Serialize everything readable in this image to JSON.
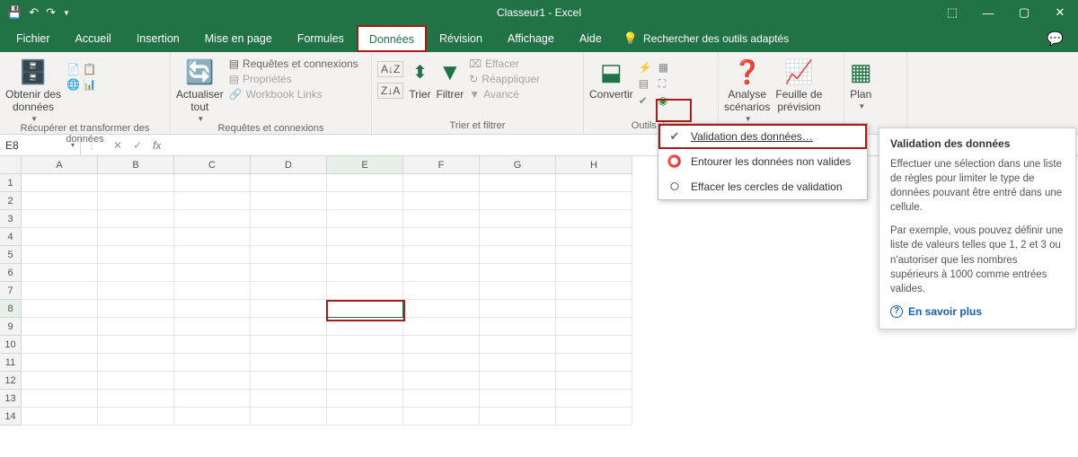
{
  "title": "Classeur1  -  Excel",
  "qat": {
    "save": "💾",
    "undo": "↶",
    "redo": "↷"
  },
  "win": {
    "opts": "⬚",
    "min": "—",
    "max": "▢",
    "close": "✕"
  },
  "tabs": {
    "items": [
      "Fichier",
      "Accueil",
      "Insertion",
      "Mise en page",
      "Formules",
      "Données",
      "Révision",
      "Affichage",
      "Aide"
    ],
    "active_index": 5,
    "tellme": "Rechercher des outils adaptés"
  },
  "ribbon": {
    "get_data_btn": "Obtenir des\ndonnées",
    "get_data_grp": "Récupérer et transformer des données",
    "refresh_btn": "Actualiser\ntout",
    "queries1": "Requêtes et connexions",
    "queries2": "Propriétés",
    "queries3": "Workbook Links",
    "queries_grp": "Requêtes et connexions",
    "sort": "Trier",
    "filter": "Filtrer",
    "clear": "Effacer",
    "reapply": "Réappliquer",
    "advanced": "Avancé",
    "sortfilter_grp": "Trier et filtrer",
    "convert": "Convertir",
    "tools_grp": "Outils de",
    "analyze": "Analyse\nscénarios",
    "forecast": "Feuille de\nprévision",
    "plan": "Plan"
  },
  "dropdown": {
    "i1": "Validation des données…",
    "i2": "Entourer les données non valides",
    "i3": "Effacer les cercles de validation"
  },
  "tooltip": {
    "title": "Validation des données",
    "p1": "Effectuer une sélection dans une liste de règles pour limiter le type de données pouvant être entré dans une cellule.",
    "p2": "Par exemple, vous pouvez définir une liste de valeurs telles que 1, 2 et 3 ou n'autoriser que les nombres supérieurs à 1000 comme entrées valides.",
    "learn": "En savoir plus"
  },
  "namebox": "E8",
  "columns": [
    "A",
    "B",
    "C",
    "D",
    "E",
    "F",
    "G",
    "H"
  ],
  "rows": [
    "1",
    "2",
    "3",
    "4",
    "5",
    "6",
    "7",
    "8",
    "9",
    "10",
    "11",
    "12",
    "13",
    "14"
  ]
}
